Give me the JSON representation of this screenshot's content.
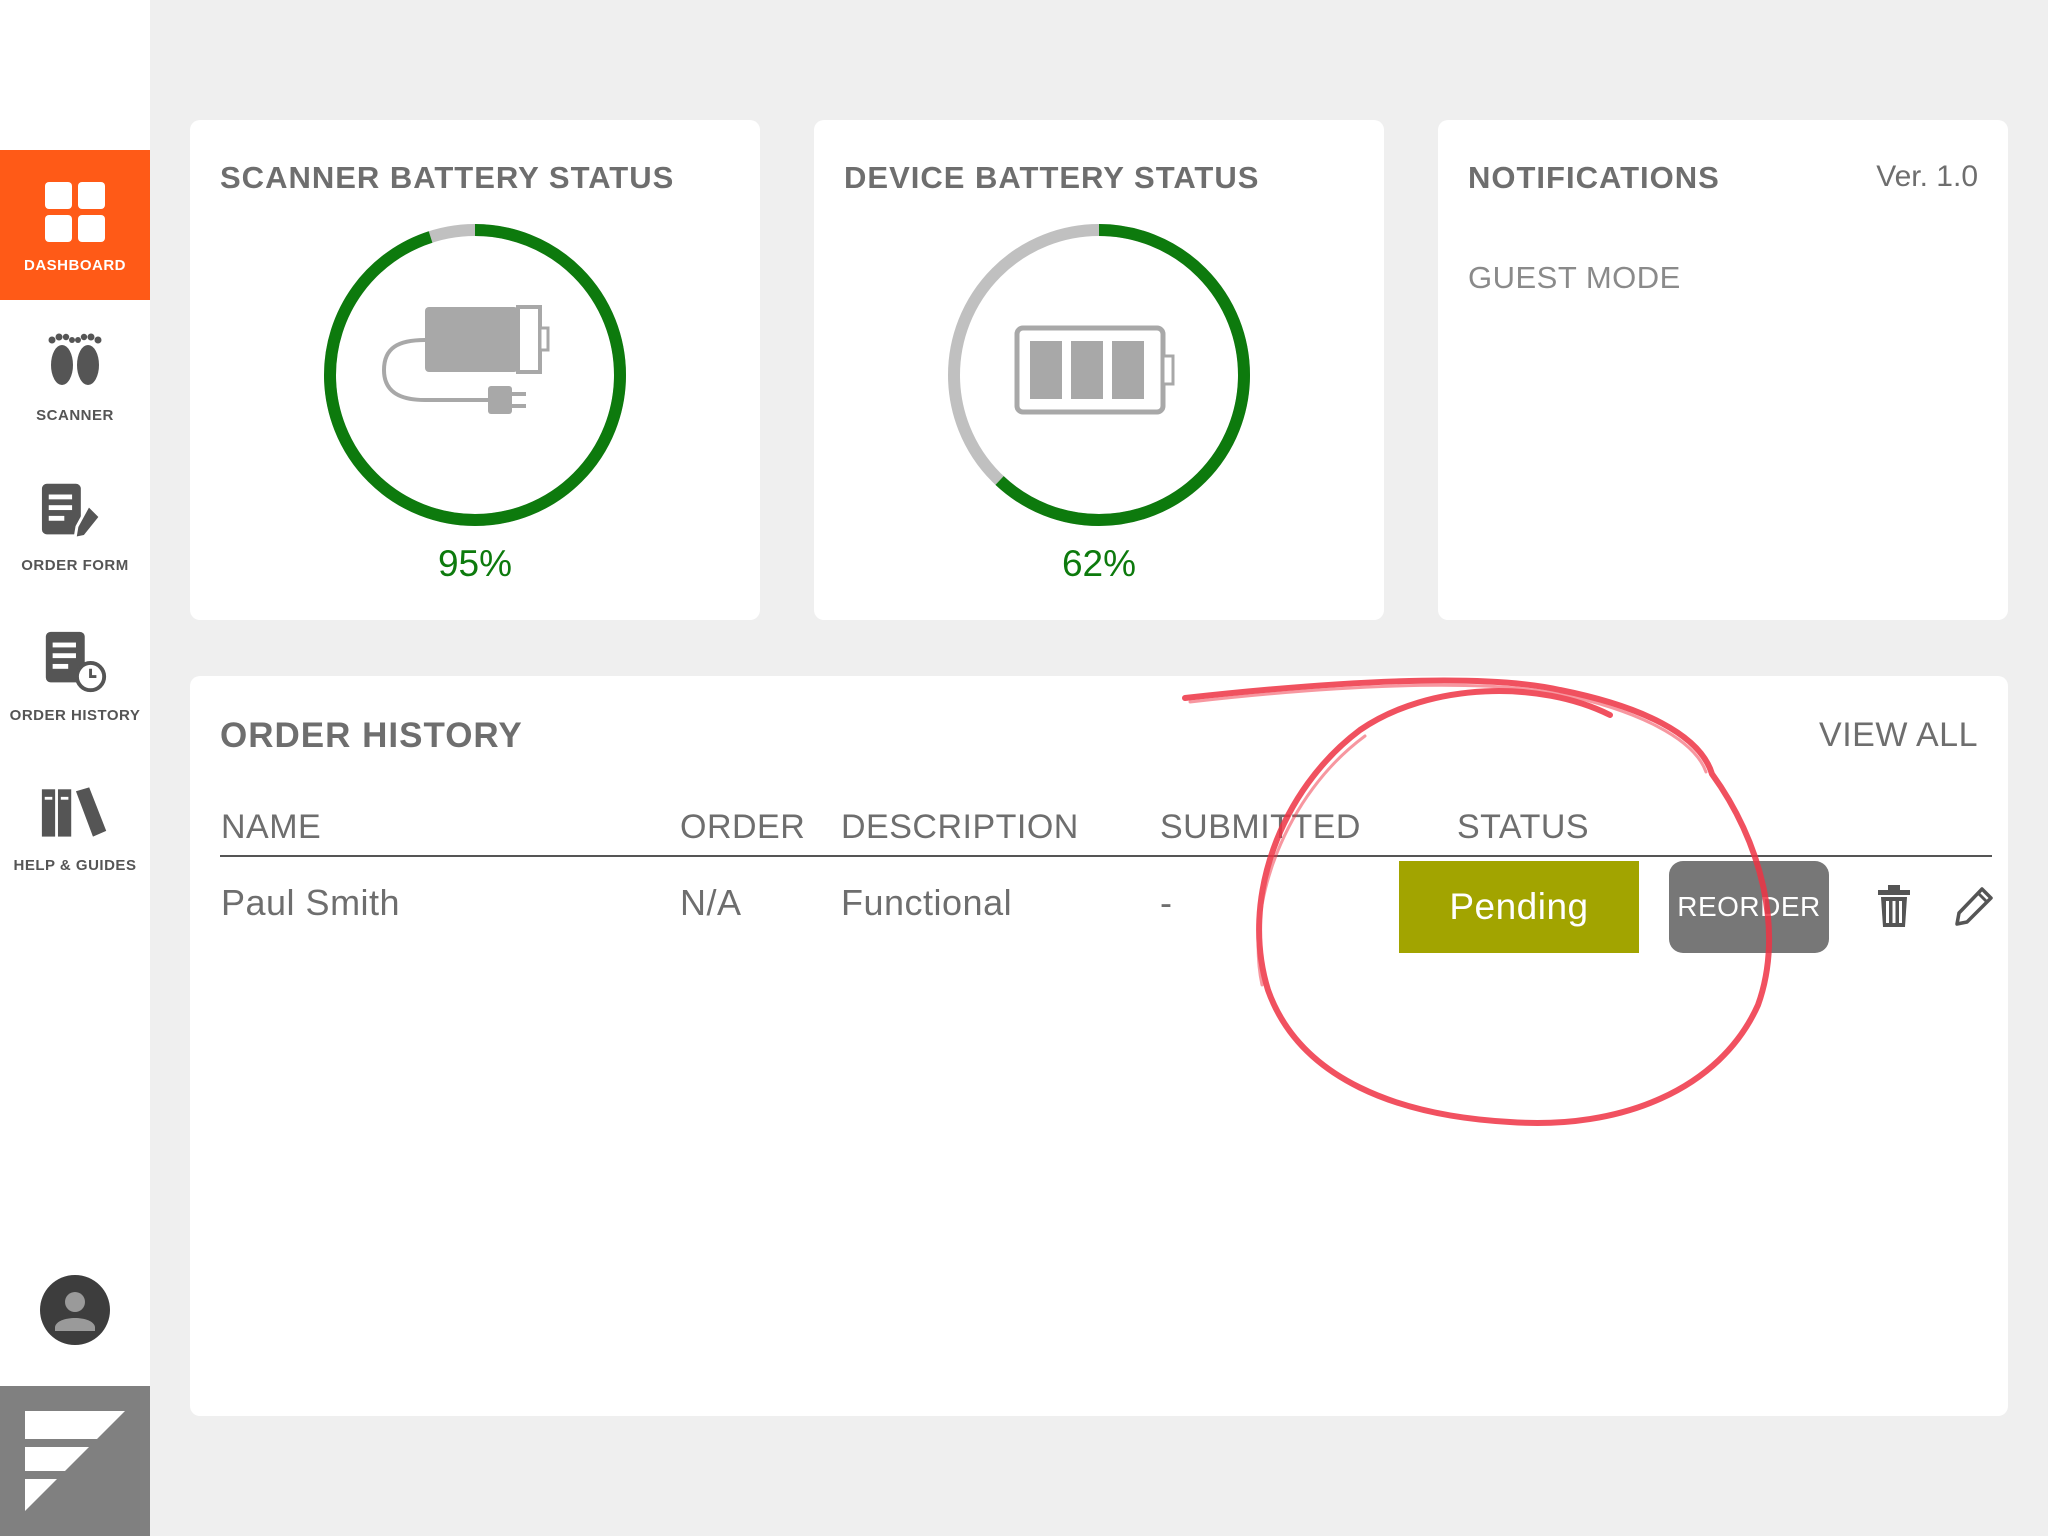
{
  "colors": {
    "accent": "#ff5a17",
    "gauge_green": "#0d7a0d",
    "gauge_track": "#c0c0c0",
    "pending": "#a2a400",
    "reorder": "#777777",
    "annotation": "#ee3344"
  },
  "sidebar": {
    "items": [
      {
        "label": "DASHBOARD",
        "icon": "dashboard-grid-icon",
        "active": true
      },
      {
        "label": "SCANNER",
        "icon": "footprints-icon",
        "active": false
      },
      {
        "label": "ORDER FORM",
        "icon": "order-form-icon",
        "active": false
      },
      {
        "label": "ORDER HISTORY",
        "icon": "order-history-icon",
        "active": false
      },
      {
        "label": "HELP & GUIDES",
        "icon": "books-icon",
        "active": false
      }
    ],
    "avatar_icon": "user-avatar-icon",
    "brand_icon": "brand-logo-icon"
  },
  "scanner_battery": {
    "title": "SCANNER BATTERY STATUS",
    "percent_label": "95%",
    "level": 0.95,
    "icon": "plugged-battery-icon"
  },
  "device_battery": {
    "title": "DEVICE BATTERY STATUS",
    "percent_label": "62%",
    "level": 0.62,
    "icon": "battery-three-bars-icon"
  },
  "notifications": {
    "title": "NOTIFICATIONS",
    "version": "Ver. 1.0",
    "message": "GUEST MODE"
  },
  "order_history": {
    "title": "ORDER HISTORY",
    "view_all": "VIEW ALL",
    "columns": [
      "NAME",
      "ORDER",
      "DESCRIPTION",
      "SUBMITTED",
      "STATUS"
    ],
    "rows": [
      {
        "name": "Paul Smith",
        "order": "N/A",
        "description": "Functional",
        "submitted": "-",
        "status": "Pending",
        "reorder_label": "REORDER"
      }
    ],
    "row_action_icons": [
      "trash-icon",
      "pencil-icon"
    ]
  }
}
